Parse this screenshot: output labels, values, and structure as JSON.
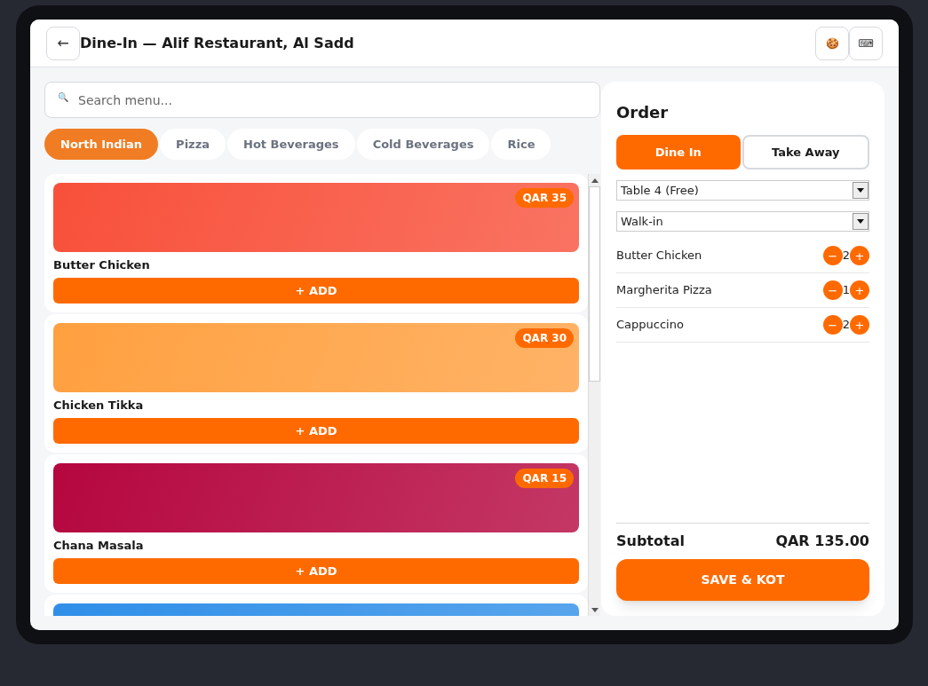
{
  "header": {
    "title": "Dine-In — Alif Restaurant, Al Sadd",
    "back": "←",
    "icons": [
      "🍪",
      "⌨"
    ]
  },
  "search": {
    "icon": "🔍",
    "placeholder": "Search menu..."
  },
  "categories": [
    {
      "label": "North Indian",
      "selected": true
    },
    {
      "label": "Pizza",
      "selected": false
    },
    {
      "label": "Hot Beverages",
      "selected": false
    },
    {
      "label": "Cold Beverages",
      "selected": false
    },
    {
      "label": "Rice",
      "selected": false
    }
  ],
  "menu_items": [
    {
      "name": "Butter Chicken",
      "price": "QAR 35",
      "color": "#f8503a",
      "add": "+ ADD"
    },
    {
      "name": "Chicken Tikka",
      "price": "QAR 30",
      "color": "#ffa040",
      "add": "+ ADD"
    },
    {
      "name": "Chana Masala",
      "price": "QAR 15",
      "color": "#b5063f",
      "add": "+ ADD"
    },
    {
      "color": "#2f8fe8"
    }
  ],
  "order": {
    "title": "Order",
    "modes": [
      {
        "label": "Dine In",
        "selected": true
      },
      {
        "label": "Take Away",
        "selected": false
      }
    ],
    "table": "Table 4 (Free)",
    "customer": "Walk-in",
    "lines": [
      {
        "name": "Butter Chicken",
        "minus": "−",
        "qty": "2",
        "plus": "+"
      },
      {
        "name": "Margherita Pizza",
        "minus": "−",
        "qty": "1",
        "plus": "+"
      },
      {
        "name": "Cappuccino",
        "minus": "−",
        "qty": "2",
        "plus": "+"
      }
    ],
    "subtotal_label": "Subtotal",
    "subtotal": "QAR 135.00",
    "submit": "SAVE & KOT"
  }
}
